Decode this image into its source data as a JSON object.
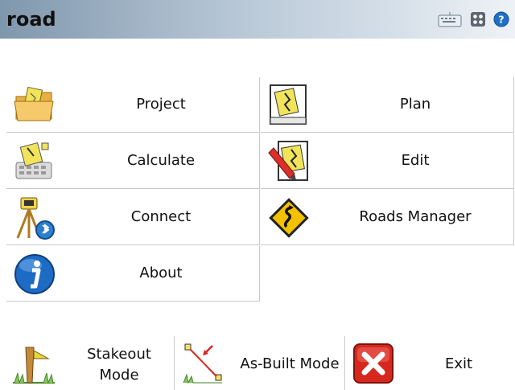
{
  "titlebar": {
    "title": "road"
  },
  "menu": {
    "project": "Project",
    "plan": "Plan",
    "calculate": "Calculate",
    "edit": "Edit",
    "connect": "Connect",
    "roads_manager": "Roads Manager",
    "about": "About"
  },
  "bottom": {
    "stakeout_line1": "Stakeout",
    "stakeout_line2": "Mode",
    "asbuilt": "As-Built Mode",
    "exit": "Exit"
  },
  "icons": {
    "keyboard": "keyboard-icon",
    "grid": "grid-icon",
    "help": "help-icon",
    "project": "folder-icon",
    "plan": "plan-icon",
    "calculate": "calculator-icon",
    "edit": "pencil-icon",
    "connect": "survey-instrument-icon",
    "roads_manager": "road-sign-icon",
    "about": "info-icon",
    "stakeout": "stake-icon",
    "asbuilt": "as-built-icon",
    "exit": "exit-icon"
  },
  "colors": {
    "help_blue": "#1f6fc4",
    "exit_red": "#d6281f",
    "road_sign_yellow": "#f2c200"
  }
}
